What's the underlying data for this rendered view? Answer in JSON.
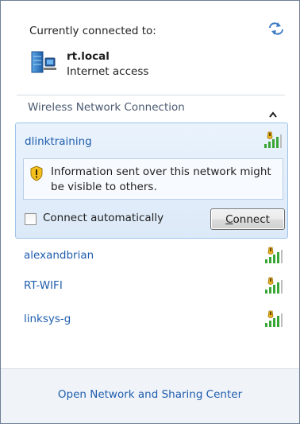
{
  "connected": {
    "heading": "Currently connected to:",
    "network_name": "rt.local",
    "network_status": "Internet access",
    "icon": "network-computer-icon",
    "refresh_icon": "refresh-arrows-icon"
  },
  "section": {
    "title": "Wireless Network Connection",
    "collapse_icon": "chevron-up-icon"
  },
  "expanded_network": {
    "name": "dlinktraining",
    "signal_icon": "wifi-signal-unsecured-icon",
    "warning_icon": "security-shield-warning-icon",
    "warning_text": "Information sent over this network might be visible to others.",
    "auto_connect_label": "Connect automatically",
    "auto_connect_checked": false,
    "connect_button_label": "Connect",
    "connect_button_accesskey_char": "C",
    "connect_button_rest": "onnect"
  },
  "networks": [
    {
      "name": "alexandbrian",
      "signal_icon": "wifi-signal-unsecured-icon"
    },
    {
      "name": "RT-WIFI",
      "signal_icon": "wifi-signal-unsecured-icon"
    },
    {
      "name": "linksys-g",
      "signal_icon": "wifi-signal-unsecured-icon"
    }
  ],
  "footer": {
    "link_label": "Open Network and Sharing Center"
  },
  "colors": {
    "link_blue": "#1f5dad",
    "panel_bg": "#dce9f8",
    "panel_border": "#9ec3ea",
    "footer_bg": "#f0f4f9"
  }
}
